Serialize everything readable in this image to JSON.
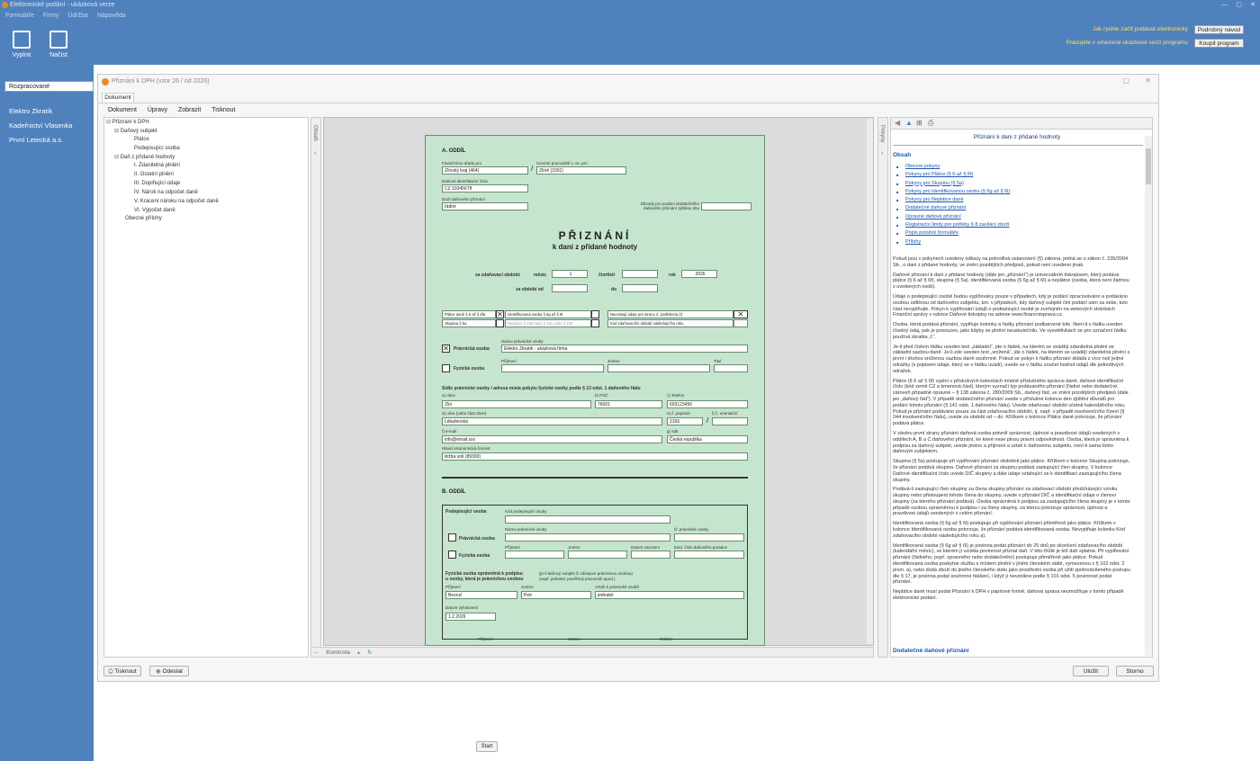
{
  "app": {
    "title": "Elektronické podání - ukázková verze",
    "menu": [
      "Formuláře",
      "Firmy",
      "Údržba",
      "Nápověda"
    ]
  },
  "toolbar": {
    "fill": "Vyplnit",
    "load": "Načíst"
  },
  "promo": {
    "line1": "Jak rychle začít podávat elektronicky",
    "btn1": "Podrobný návod",
    "line2": "Pracujete v omezené ukázkové verzi programu",
    "btn2": "Koupit program"
  },
  "left": {
    "filter": "Rozpracované",
    "companies": [
      "Elektro Zkratík",
      "Kadeřnictví Vlasenka",
      "První Letecká a.s."
    ]
  },
  "dialog": {
    "title": "Přiznání k DPH (vzor 26 / od 2026)",
    "tab": "Dokument",
    "menu": [
      "Dokument",
      "Úpravy",
      "Zobrazit",
      "Tisknout"
    ],
    "print": "Tisknout",
    "send": "Odeslat",
    "save": "Uložit",
    "cancel": "Storno",
    "status": "Kontrola",
    "panel_obsah": "Obsah",
    "panel_pokyny": "Pokyny"
  },
  "tree": [
    "Přiznání k DPH",
    "Daňový subjekt",
    "Plátce",
    "Podepisující osoba",
    "Daň z přidané hodnoty",
    "I. Zdanitelná plnění",
    "II. Ostatní plnění",
    "III. Doplňující údaje",
    "IV. Nárok na odpočet daně",
    "V. Krácení nároku na odpočet daně",
    "VI. Výpočet daně",
    "Obecné přílohy"
  ],
  "form": {
    "sectA": "A. ODDÍL",
    "fu_l": "Finančnímu úřadu pro",
    "fu": "Zlínský kraj (464)",
    "up_l": "Územní pracoviště v, ve, pro",
    "up": "Zlíně (3301)",
    "dic_l": "Daňové identifikační číslo",
    "dic": "CZ 33345678",
    "druh_l": "Druh daňového přiznání",
    "druh": "řádné",
    "duvod_l": "Důvody pro podání dodatečného daňového přiznání zjištěny dne",
    "title1": "PŘIZNÁNÍ",
    "title2": "k dani z přidané hodnoty",
    "obdobi_l": "za zdaňovací období:",
    "mesic_l": "měsíc",
    "mesic": "1",
    "ctvrtleti_l": "čtvrtletí",
    "rok_l": "rok",
    "rok": "2026",
    "od_l": "za období od",
    "do_l": "do",
    "platce": "Plátce daně § 6 až § 6fa",
    "ident": "Identifikovaná osoba § 6g až § 6l",
    "neexist": "Neexistují údaje pro stranu 2. podkriteria (!)",
    "skupina": "Skupina § 5a",
    "neplatce": "Neplátce § 196 nebo § 19c nebo § 108",
    "kod_obd": "Kód zdaňovacího období následujícího roku",
    "pravnicka": "Právnická osoba",
    "nazev_l": "Název právnické osoby",
    "nazev": "Elektro Zkratík - ukázková firma",
    "fyzicka": "Fyzická osoba",
    "prijmeni_l": "Příjmení",
    "jmeno_l": "Jméno",
    "titul_l": "Titul",
    "sidlo": "Sídlo právnické osoby / adresa místa pobytu fyzické osoby podle § 13 odst. 1 daňového řádu",
    "obec_l": "a) obec",
    "obec": "Zlín",
    "psc_l": "b) PSČ",
    "psc": "76001",
    "tel_l": "c) Telefon",
    "tel": "603123456",
    "ulice_l": "d) ulice (nebo část obce)",
    "ulice": "Lékařenská",
    "cp_l": "e) č. popisné",
    "cp": "2156",
    "co_l": "f) č. orientační",
    "email_l": "f) e-mail",
    "email": "info@email.xxx",
    "stat_l": "g) stát",
    "stat": "Česká republika",
    "cinnost_l": "Hlavní ekonomická činnost",
    "cinnost": "těžba solí (89300)",
    "sectB": "B. ODDÍL",
    "podep": "Podepisující osoba",
    "kod_podep_l": "Kód podepisující osoby",
    "nazev_po_l": "Název právnické osoby",
    "ic_l": "IČ právnické osoby",
    "b_prav": "Právnická osoba",
    "b_fyz": "Fyzická osoba",
    "b_prijmeni_l": "Příjmení",
    "b_jmeno_l": "Jméno",
    "datum_nar_l": "Datum narození",
    "evid_l": "Evid. číslo daňového poradce",
    "opravnena1": "Fyzická osoba oprávněná k podpisu",
    "opravnena2": "u osoby, která je právnickou osobou",
    "opravnena3": "(je-li daňový subjekt či zástupce právnickou osobou)",
    "opravnena4": "(např. jednatel, pověřený pracovník apod.)",
    "c_prijmeni": "Bezruč",
    "c_jmeno": "Petr",
    "vztah_l": "Vztah k právnické osobě",
    "vztah": "jednatel",
    "datum_vyh_l": "Datum vyhotovení",
    "datum_vyh": "1.2.2026",
    "tel2_l": "Telefon"
  },
  "help": {
    "title": "Přiznání k dani z přidané hodnoty",
    "obsah": "Obsah",
    "links": [
      "Obecné pokyny",
      "Pokyny pro Plátce (§ 6 až § 6f)",
      "Pokyny pro Skupinu (§ 5a)",
      "Pokyny pro Identifikovanou osobu (§ 6g až § 6l)",
      "Pokyny pro Neplátce daně",
      "Dodatečné daňové přiznání",
      "Opravné daňové přiznání",
      "Registrační limity pro potřeby § 8 zasílání zboží",
      "Popis položek formuláře",
      "Přílohy"
    ],
    "paragraphs": [
      "Pokud jsou v pokynech uvedeny odkazy na jednotlivá ustanovení (§) zákona, jedná se o zákon č. 235/2004 Sb., o dani z přidané hodnoty, ve znění pozdějších předpisů, pokud není uvedeno jinak.",
      "Daňové přiznání k dani z přidané hodnoty (dále jen „přiznání“) je univerzálním tiskopisem, který podává plátce (§ 6 až § 6f), skupina (§ 5a), identifikovaná osoba (§ 6g až § 6l) a neplátce (osoba, která není žádnou z uvedených osob).",
      "Údaje o podepisující osobě budou vyplňovány pouze v případech, kdy je podání zpracováváno a podáváno osobou odlišnou od daňového subjektu, tzn. v případech, kdy daňový subjekt činí podání sám za sebe, tuto část nevyplňujte. Pokyn k vyplňování údajů o podepisující osobě je zveřejněn na webových stránkách Finanční správy v rubrice Daňové tiskopisy na adrese www.financnisprava.cz.",
      "Osoba, která podává přiznání, vyplňuje kolonky a řádky přiznání podbarvené bíle. Není-li v řádku uveden číselný údaj, pak je posouzen, jako kdyby se plnění neuskutečnilo. Ve vysvětlivkách se pro označení řádku používá zkratka „ř.“.",
      "Je-li před číslem řádku uveden text „základní“, jde o řádek, na kterém se uvádějí zdanitelná plnění se základní sazbou daně. Je-li zde uveden text „snížená“, jde o řádek, na kterém se uvádějí zdanitelná plnění s první i druhou sníženou sazbou daně souhrnně. Pokud se pokyn k řádku přiznání skládá z více než jedné odrážky (s popisem údaje, který se v řádku uvádí), uvede se v řádku součet hodnot údajů dle jednotlivých odrážek.",
      "Plátce (§ 6 až § 6f) vyplní v příslušných kolonkách místně příslušného správce daně, daňové identifikační číslo (kód země CZ a kmenová část), kterým vyznačí typ podávaného přiznání (řádné nebo dodatečné, zároveň případně opravné – § 138 zákona č. 280/2009 Sb., daňový řád, ve znění pozdějších předpisů (dále jen „daňový řád“). V případě dodatečného přiznání uvede v příslušné kolonce den zjištění důvodů pro podání tohoto přiznání (§ 141 odst. 1 daňového řádu). Uvede zdaňovací období včetně kalendářního roku. Pokud je přiznání podáváno pouze za část zdaňovacího období, tj. např. v případě insolvenčního řízení (§ 244 insolvenčního řádu), uvede za období od – do. Křížkem v kolonce Plátce daně potvrzuje, že přiznání podává plátce.",
      "V závěru první strany přiznání daňová osoba potvrdí správnost, úplnost a pravdivost údajů uvedených v oddílech A, B a C daňového přiznání, ke které nese plnou právní odpovědnost. Osoba, která je oprávněna k podpisu za daňový subjekt, uvede jméno a příjmení a vztah k daňovému subjektu, není-li sama tímto daňovým subjektem.",
      "Skupina (§ 5a) postupuje při vyplňování přiznání obdobně jako plátce. Křížkem v kolonce Skupina potvrzuje, že přiznání podává skupina. Daňové přiznání za skupinu podává zastupující člen skupiny. V kolonce Daňové identifikační číslo uvede DIČ skupiny a dále údaje vztahující se k identifikaci zastupujícího člena skupiny.",
      "Podává-li zastupující člen skupiny za člena skupiny přiznání za zdaňovací období předcházející vzniku skupiny nebo přistoupení tohoto člena do skupiny, uvede v přiznání DIČ a identifikační údaje o členovi skupiny (za kterého přiznání podává). Osoba oprávněná k podpisu za zastupujícího člena skupiny je v tomto případě osobou oprávněnou k podpisu i za členy skupiny, za kterou potvrzuje správnost, úplnost a pravdivost údajů uvedených v celém přiznání.",
      "Identifikovaná osoba (§ 6g až § 6l) postupuje při vyplňování přiznání přiměřeně jako plátce. Křížkem v kolonce Identifikovaná osoba potvrzuje, že přiznání podává identifikovaná osoba. Nevyplňuje kolonku Kód zdaňovacího období následujícího roku a).",
      "Identifikovaná osoba (§ 6g až § 6l) je povinna podat přiznání do 25 dnů po skončení zdaňovacího období (kalendářní měsíc), ve kterém jí vznikla povinnost přiznat daň. V této lhůtě je též daň splatná. Při vyplňování přiznání (řádného, popř. opravného nebo dodatečného) postupuje přiměřeně jako plátce. Pokud identifikovaná osoba poskytne službu s místem plnění v jiném členském státě, vymezenou v § 102 odst. 2 písm. a), nebo dodá zboží do jiného členského státu jako prostřední osoba při užití zjednodušeného postupu dle § 17, je povinna podat souhrnné hlášení, i když jí nevznikne podle § 101 odst. 5 povinnost podat přiznání.",
      "Neplátce daně musí podat Přiznání k DPH v papírové formě, daňová správa neumožňuje v tomto případě elektronické podání."
    ],
    "footer": "Dodatečné daňové přiznání"
  },
  "start": "Start",
  "colors": {
    "chrome": "#4f81bd",
    "form_bg": "#c6e5ce",
    "promo": "#ffe066",
    "link": "#1a56b0"
  }
}
